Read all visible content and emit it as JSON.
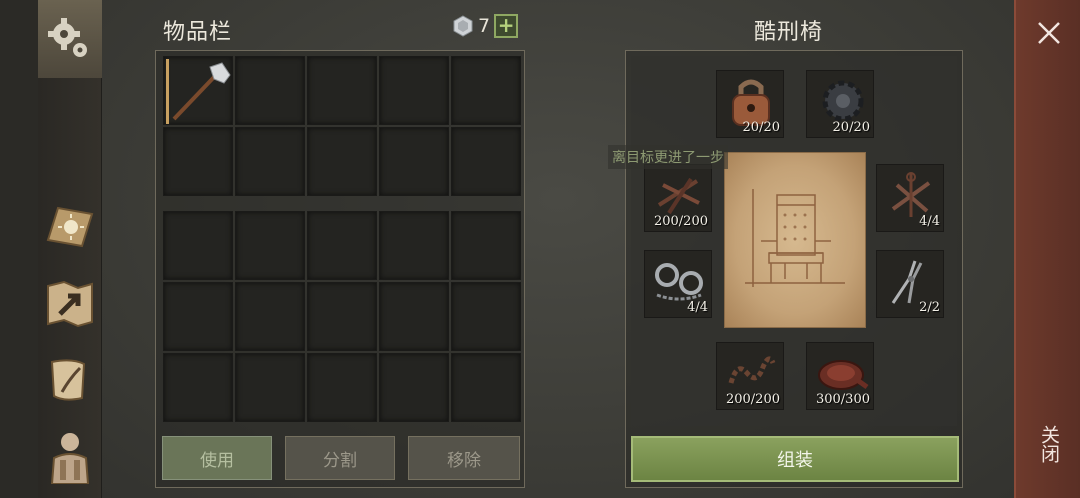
{
  "inventory": {
    "title": "物品栏",
    "currency_count": "7",
    "add_label": "+"
  },
  "buttons": {
    "use": "使用",
    "split": "分割",
    "remove": "移除"
  },
  "crafting": {
    "title": "酷刑椅",
    "tooltip": "离目标更进了一步",
    "assemble": "组装",
    "materials": [
      {
        "name": "padlock-icon",
        "count": "20/20"
      },
      {
        "name": "gear-icon",
        "count": "20/20"
      },
      {
        "name": "nails-icon",
        "count": "200/200"
      },
      {
        "name": "rack-icon",
        "count": "4/4"
      },
      {
        "name": "shackles-icon",
        "count": "4/4"
      },
      {
        "name": "pliers-icon",
        "count": "2/2"
      },
      {
        "name": "chain-icon",
        "count": "200/200"
      },
      {
        "name": "leather-icon",
        "count": "300/300"
      }
    ]
  },
  "close": {
    "label": "关闭",
    "x": "×"
  },
  "colors": {
    "accent_green": "#7d9450",
    "close_panel": "#6e3a2c",
    "background": "#3c3b36"
  }
}
